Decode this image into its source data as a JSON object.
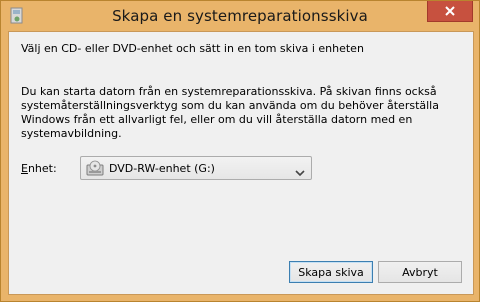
{
  "window": {
    "title": "Skapa en systemreparationsskiva",
    "close_symbol": "✕"
  },
  "content": {
    "instruction": "Välj en CD- eller DVD-enhet och sätt in en tom skiva i enheten",
    "description": "Du kan starta datorn från en systemreparationsskiva. På skivan finns också\nsystemåterställningsverktyg som du kan använda om du behöver återställa\nWindows från ett allvarligt fel, eller om du vill återställa datorn med en\nsystemavbildning.",
    "drive_label": "Enhet:",
    "drive_selected": "DVD-RW-enhet (G:)"
  },
  "buttons": {
    "create": "Skapa skiva",
    "cancel": "Avbryt"
  },
  "colors": {
    "window_frame": "#e9b46a",
    "close_button": "#c7513f",
    "client_bg": "#f0f0f0"
  }
}
